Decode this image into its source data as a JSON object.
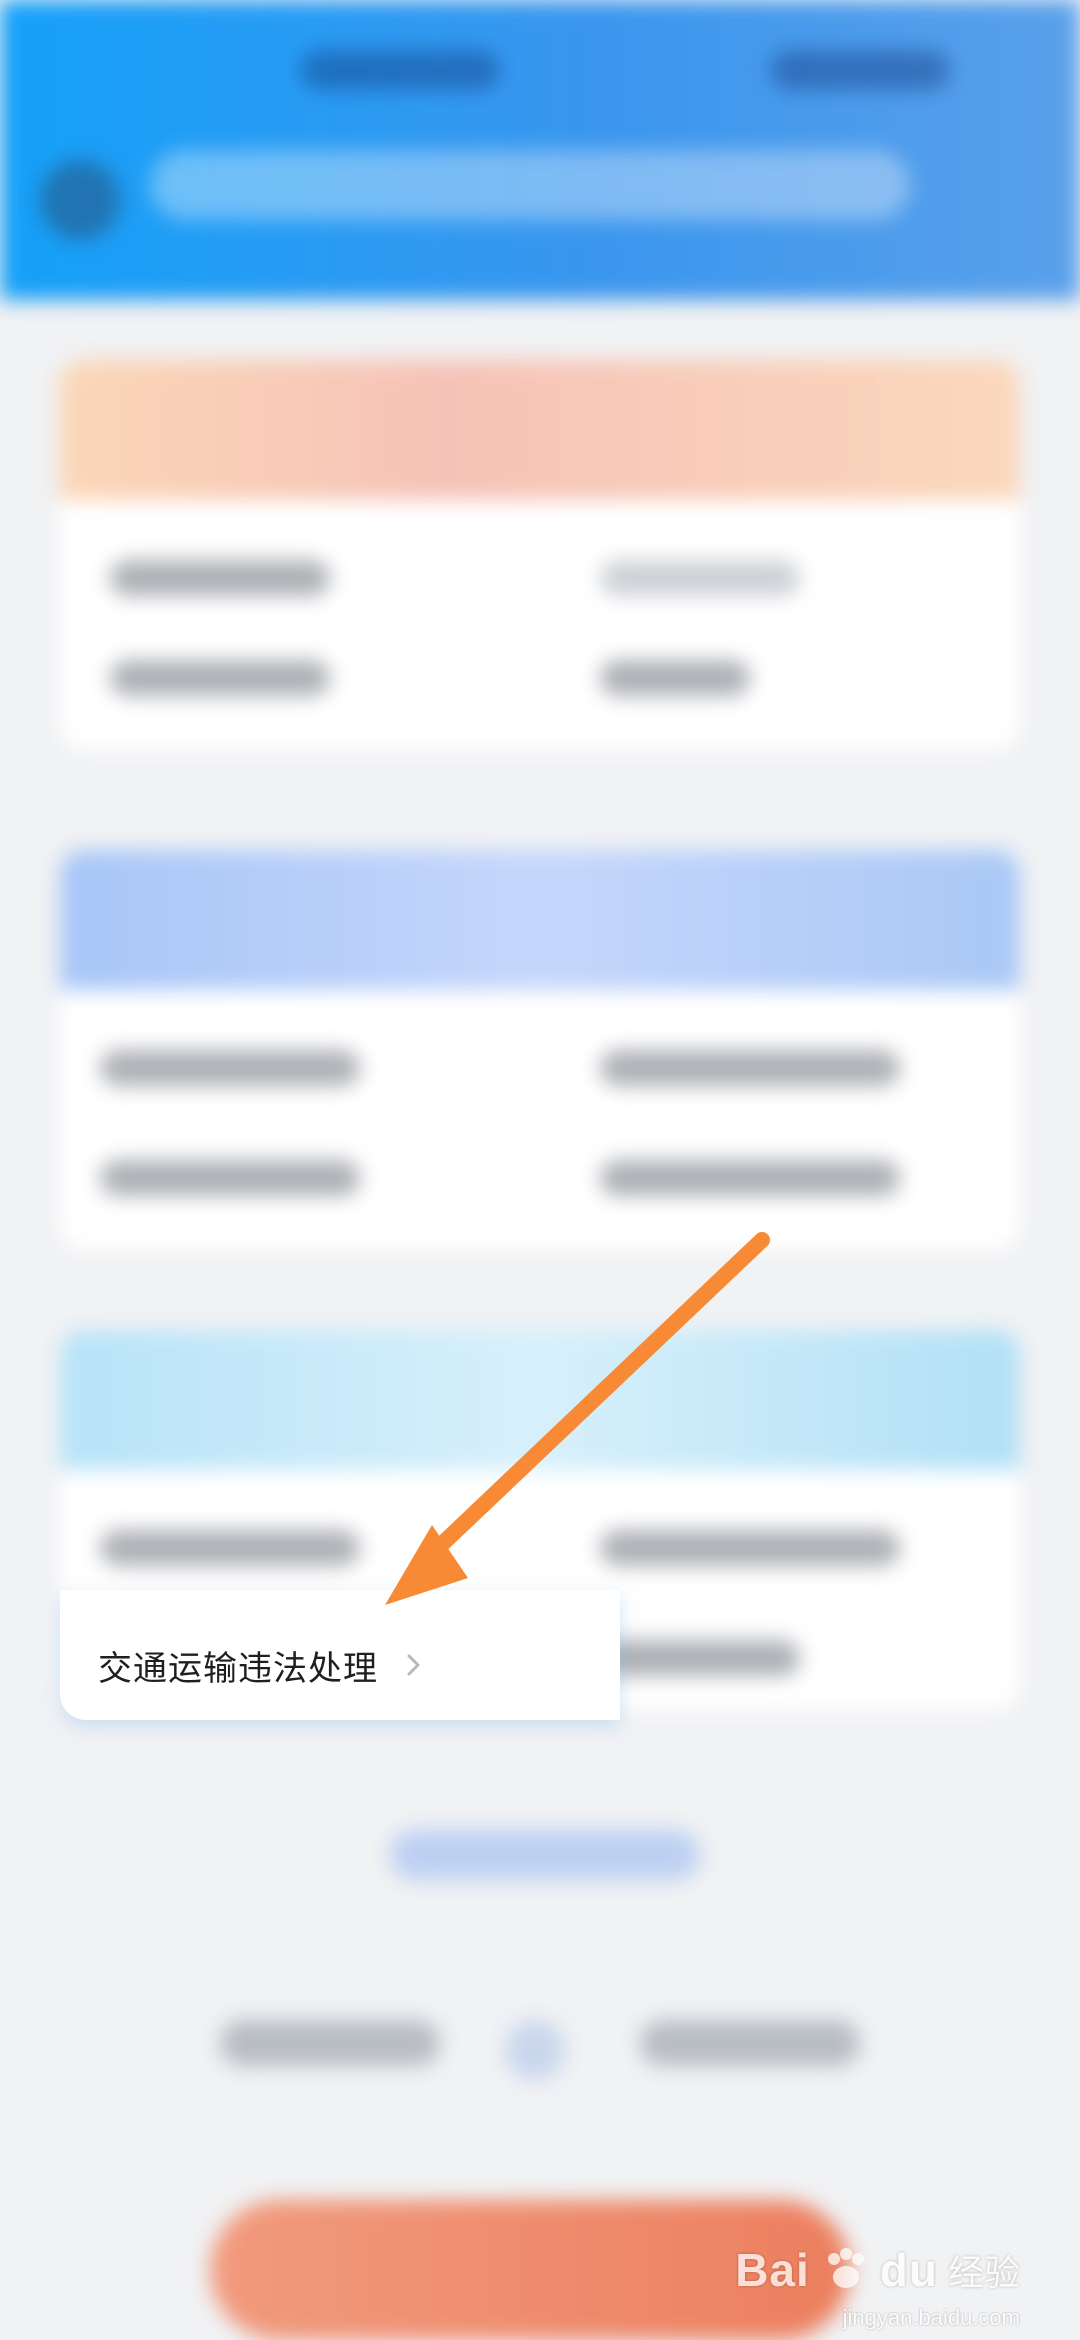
{
  "highlighted_service": {
    "label": "交通运输违法处理",
    "chevron_icon": "chevron-right-icon"
  },
  "annotation": {
    "type": "arrow",
    "color": "#f88a35",
    "points_to": "交通运输违法处理"
  },
  "colors": {
    "header_start": "#14a0f8",
    "header_end": "#5aa0ea",
    "card1_head": "#fbd7b7",
    "card2_head": "#a7c6f7",
    "card3_head": "#b7e3f8",
    "bottom_button": "#ec7f5e"
  },
  "watermark": {
    "brand": "Bai",
    "brand_suffix": "du",
    "cn": "经验",
    "sub": "jingyan.baidu.com"
  }
}
